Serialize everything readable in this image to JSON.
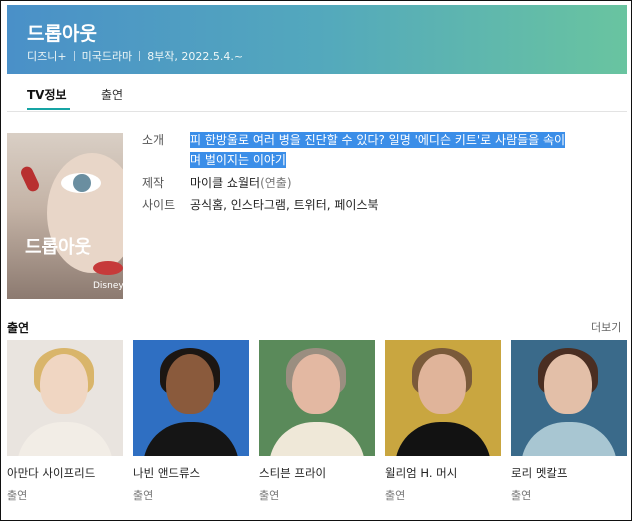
{
  "show": {
    "title": "드롭아웃",
    "platform": "디즈니+",
    "genre": "미국드라마",
    "episodes": "8부작, 2022.5.4.~"
  },
  "tabs": [
    {
      "label": "TV정보",
      "active": true
    },
    {
      "label": "출연",
      "active": false
    }
  ],
  "poster": {
    "title": "드롭아웃",
    "brand": "Disney+"
  },
  "info": {
    "synopsis_label": "소개",
    "synopsis_line1": "피 한방울로 여러 병을 진단할 수 있다? 일명 '에디슨 키트'로 사람들을 속이",
    "synopsis_line2": "며 벌이지는 이야기",
    "production_label": "제작",
    "production_value": "마이클 쇼월터",
    "production_role": "(연출)",
    "sites_label": "사이트",
    "sites": [
      "공식홈",
      "인스타그램",
      "트위터",
      "페이스북"
    ],
    "sites_sep": ", "
  },
  "cast": {
    "heading": "출연",
    "more": "더보기",
    "members": [
      {
        "name": "아만다 사이프리드",
        "role": "출연"
      },
      {
        "name": "나빈 앤드류스",
        "role": "출연"
      },
      {
        "name": "스티븐 프라이",
        "role": "출연"
      },
      {
        "name": "윌리엄 H. 머시",
        "role": "출연"
      },
      {
        "name": "로리 멧칼프",
        "role": "출연"
      }
    ]
  },
  "colors": {
    "accent": "#16a4a4",
    "selection": "#3b8ee8"
  }
}
